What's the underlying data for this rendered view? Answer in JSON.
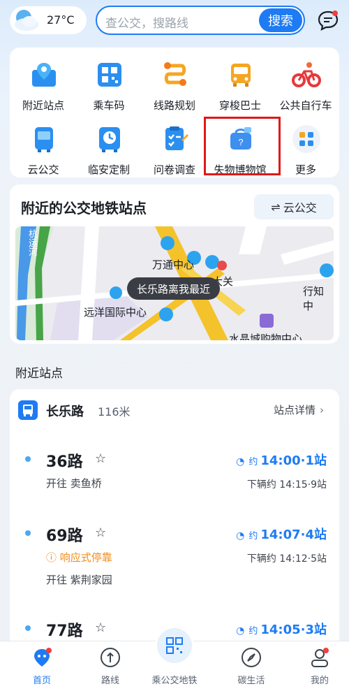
{
  "weather": {
    "temperature": "27°C",
    "icon": "cloud-sun-icon"
  },
  "search": {
    "placeholder": "查公交，搜路线",
    "button_label": "搜索"
  },
  "quick_actions": [
    {
      "label": "附近站点",
      "icon": "nearby-stops-icon"
    },
    {
      "label": "乘车码",
      "icon": "qr-ride-code-icon"
    },
    {
      "label": "线路规划",
      "icon": "route-plan-icon"
    },
    {
      "label": "穿梭巴士",
      "icon": "shuttle-bus-icon"
    },
    {
      "label": "公共自行车",
      "icon": "bicycle-icon"
    },
    {
      "label": "云公交",
      "icon": "cloud-bus-icon"
    },
    {
      "label": "临安定制",
      "icon": "custom-bus-icon"
    },
    {
      "label": "问卷调查",
      "icon": "survey-icon"
    },
    {
      "label": "失物博物馆",
      "icon": "lost-found-icon"
    },
    {
      "label": "更多",
      "icon": "more-icon"
    }
  ],
  "nearby_card": {
    "title": "附近的公交地铁站点",
    "cloud_button": "云公交",
    "map_tooltip": "长乐路离我最近",
    "map_labels": [
      "万通中心",
      "大关",
      "远洋国际中心",
      "行知中",
      "水晶城购物中心",
      "杭运河"
    ]
  },
  "section_label": "附近站点",
  "stop": {
    "name": "长乐路",
    "distance": "116米",
    "detail_link": "站点详情",
    "routes": [
      {
        "number": "36路",
        "destination": "开往 卖鱼桥",
        "eta_prefix": "约",
        "eta": "14:00·1站",
        "next": "下辆约 14:15·9站",
        "responsive": ""
      },
      {
        "number": "69路",
        "destination": "开往 紫荆家园",
        "eta_prefix": "约",
        "eta": "14:07·4站",
        "next": "下辆约 14:12·5站",
        "responsive": "响应式停靠"
      },
      {
        "number": "77路",
        "destination": "",
        "eta_prefix": "约",
        "eta": "14:05·3站",
        "next": "",
        "responsive": ""
      }
    ]
  },
  "tabbar": [
    {
      "label": "首页",
      "icon": "home-icon",
      "active": true
    },
    {
      "label": "路线",
      "icon": "route-icon",
      "active": false
    },
    {
      "label": "乘公交地铁",
      "icon": "qr-code-icon",
      "active": false
    },
    {
      "label": "碳生活",
      "icon": "compass-icon",
      "active": false
    },
    {
      "label": "我的",
      "icon": "profile-icon",
      "active": false
    }
  ],
  "colors": {
    "accent": "#1e7bf3",
    "highlight_box": "#e01818",
    "warning": "#f08c1c"
  }
}
